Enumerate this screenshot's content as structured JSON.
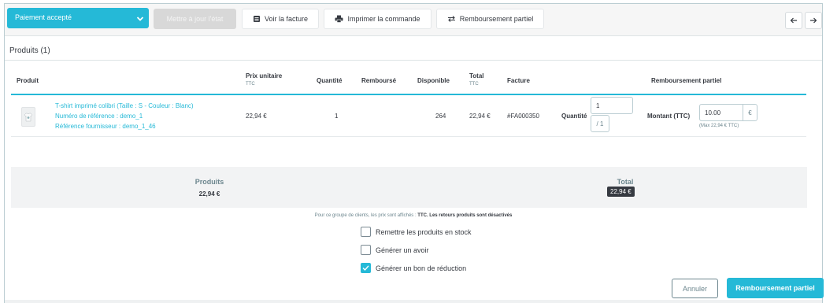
{
  "toolbar": {
    "status_select": "Paiement accepté",
    "update_status": "Mettre à jour l'état",
    "view_invoice": "Voir la facture",
    "print_order": "Imprimer la commande",
    "partial_refund": "Remboursement partiel"
  },
  "products_panel": {
    "title": "Produits (1)",
    "headers": {
      "product": "Produit",
      "unit_price": "Prix unitaire",
      "unit_price_sub": "TTC",
      "quantity": "Quantité",
      "refunded": "Remboursé",
      "available": "Disponible",
      "total": "Total",
      "total_sub": "TTC",
      "invoice": "Facture",
      "partial_refund": "Remboursement partiel"
    },
    "row": {
      "name": "T-shirt imprimé colibri (Taille : S - Couleur : Blanc)",
      "reference": "Numéro de référence : demo_1",
      "supplier_reference": "Référence fournisseur : demo_1_46",
      "unit_price": "22,94 €",
      "quantity": "1",
      "available": "264",
      "total": "22,94 €",
      "invoice": "#FA000350",
      "refund_qty_label": "Quantité",
      "refund_qty_value": "1",
      "refund_qty_max": "/ 1",
      "refund_amount_label": "Montant (TTC)",
      "refund_amount_value": "10.00",
      "currency": "€",
      "refund_amount_max": "(Max 22,94 € TTC)"
    }
  },
  "totals": {
    "products_label": "Produits",
    "products_value": "22,94 €",
    "total_label": "Total",
    "total_value": "22,94 €"
  },
  "notice": {
    "text": "Pour ce groupe de clients, les prix sont affichés :",
    "strong": "TTC. Les retours produits sont désactivés"
  },
  "options": [
    {
      "label": "Remettre les produits en stock",
      "checked": false
    },
    {
      "label": "Générer un avoir",
      "checked": false
    },
    {
      "label": "Générer un bon de réduction",
      "checked": true
    }
  ],
  "actions": {
    "cancel": "Annuler",
    "submit": "Remboursement partiel"
  },
  "colors": {
    "accent": "#25b9d7",
    "text": "#363a41",
    "muted": "#6c868e"
  }
}
